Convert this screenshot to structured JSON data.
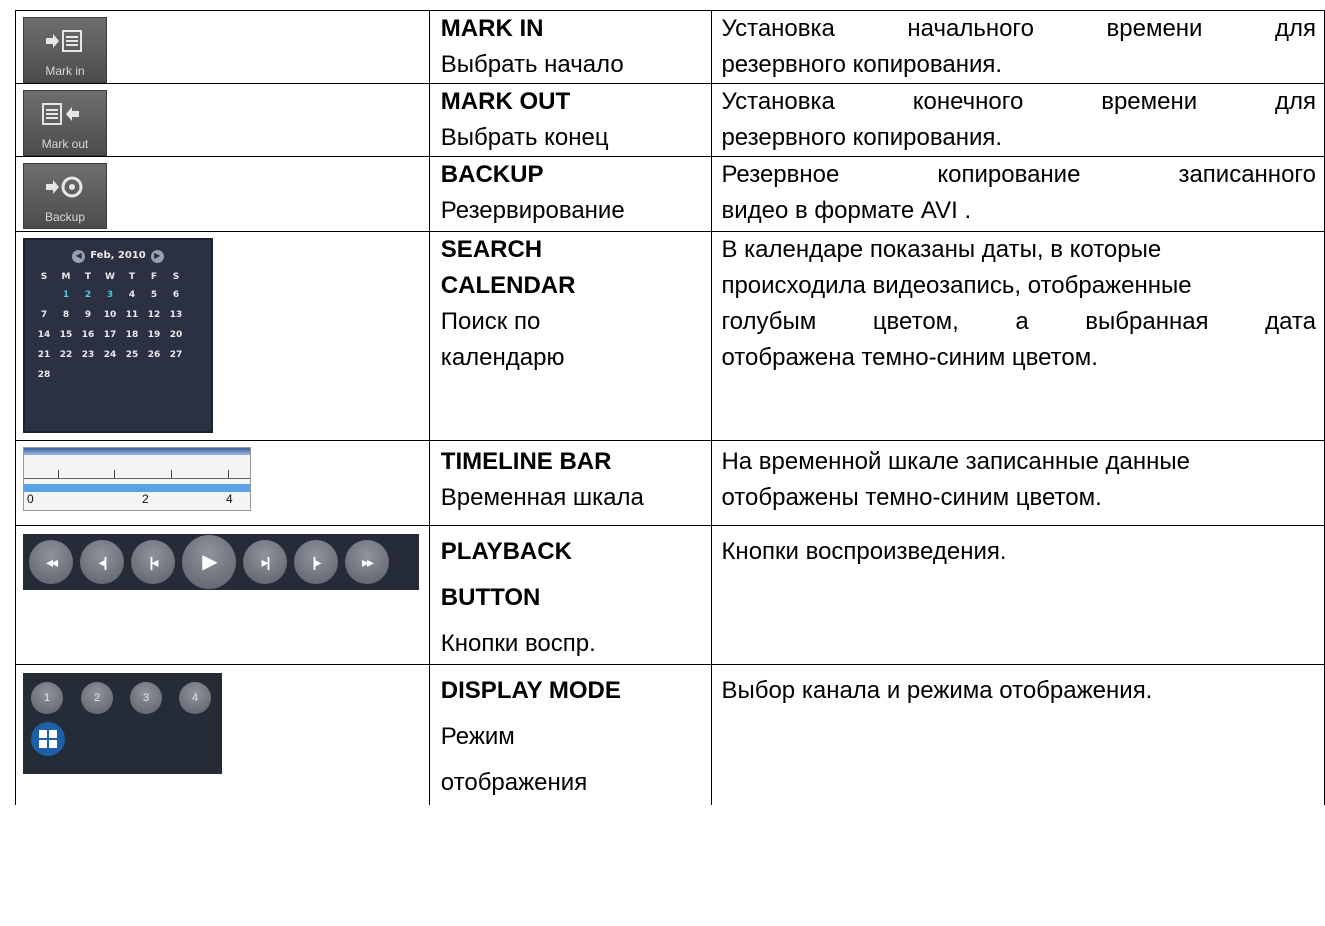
{
  "rows": [
    {
      "title": "MARK IN",
      "subtitle": "Выбрать начало",
      "desc_words": [
        "Установка",
        "начального",
        "времени",
        "для"
      ],
      "desc_line2": "резервного копирования.",
      "icon_caption": "Mark in",
      "icon": "mark-in-icon"
    },
    {
      "title": "MARK OUT",
      "subtitle": "Выбрать конец",
      "desc_words": [
        "Установка",
        "конечного",
        "времени",
        "для"
      ],
      "desc_line2": "резервного копирования.",
      "icon_caption": "Mark out",
      "icon": "mark-out-icon"
    },
    {
      "title": "BACKUP",
      "subtitle": "Резервирование",
      "desc_words": [
        "Резервное",
        "копирование",
        "записанного"
      ],
      "desc_line2": "видео в формате AVI .",
      "icon_caption": "Backup",
      "icon": "backup-icon"
    },
    {
      "title_line1": "SEARCH",
      "title_line2": "CALENDAR",
      "subtitle_line1": "Поиск по",
      "subtitle_line2": "календарю",
      "desc_lines": [
        "В календаре показаны даты, в которые",
        "происходила видеозапись, отображенные"
      ],
      "desc_words3": [
        "голубым",
        "цветом,",
        "а",
        "выбранная",
        "дата"
      ],
      "desc_line4": "отображена темно-синим цветом.",
      "calendar": {
        "month": "Feb, 2010",
        "weekdays": [
          "S",
          "M",
          "T",
          "W",
          "T",
          "F",
          "S"
        ],
        "days": [
          "",
          "1",
          "2",
          "3",
          "4",
          "5",
          "6",
          "7",
          "8",
          "9",
          "10",
          "11",
          "12",
          "13",
          "14",
          "15",
          "16",
          "17",
          "18",
          "19",
          "20",
          "21",
          "22",
          "23",
          "24",
          "25",
          "26",
          "27",
          "28"
        ],
        "recorded_days": [
          "1",
          "2",
          "3"
        ],
        "selected_day": "3",
        "recorded_color": "#5ac8ee"
      }
    },
    {
      "title": "TIMELINE BAR",
      "subtitle": "Временная шкала",
      "desc_lines": [
        "На временной шкале записанные данные",
        "отображены темно-синим цветом."
      ],
      "timeline_labels": [
        "0",
        "2",
        "4"
      ]
    },
    {
      "title_line1": "PLAYBACK",
      "title_line2": "BUTTON",
      "subtitle": "Кнопки воспр.",
      "desc": "Кнопки воспроизведения.",
      "buttons": [
        "fast-rewind-icon",
        "step-back-icon",
        "skip-back-icon",
        "play-icon",
        "skip-forward-icon",
        "step-forward-icon",
        "fast-forward-icon"
      ],
      "button_glyphs": [
        "◂◂",
        "◂|",
        "|◂",
        "▶",
        "▸|",
        "|▸",
        "▸▸"
      ]
    },
    {
      "title": "DISPLAY MODE",
      "subtitle_line1": "Режим",
      "subtitle_line2": "отображения",
      "desc": "Выбор канала и режима отображения.",
      "channels": [
        "1",
        "2",
        "3",
        "4"
      ]
    }
  ]
}
